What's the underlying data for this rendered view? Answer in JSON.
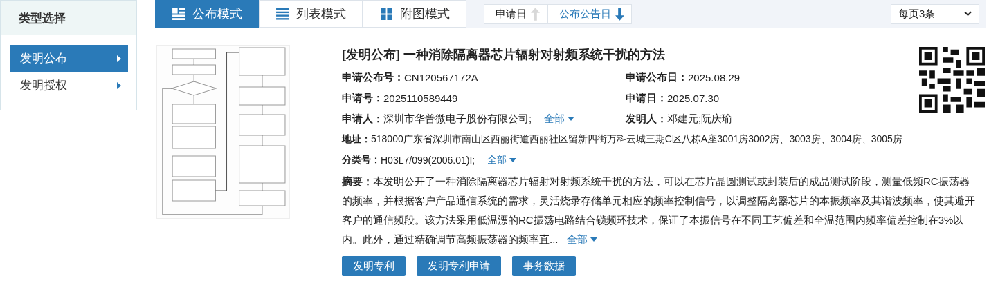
{
  "sidebar": {
    "title": "类型选择",
    "items": [
      {
        "label": "发明公布",
        "selected": true
      },
      {
        "label": "发明授权",
        "selected": false
      }
    ]
  },
  "view_tabs": [
    {
      "label": "公布模式",
      "kind": "publication",
      "selected": true
    },
    {
      "label": "列表模式",
      "kind": "list",
      "selected": false
    },
    {
      "label": "附图模式",
      "kind": "figure",
      "selected": false
    }
  ],
  "sort_buttons": [
    {
      "label": "申请日",
      "descending": false,
      "active": false
    },
    {
      "label": "公布公告日",
      "descending": true,
      "active": true
    }
  ],
  "page_size": {
    "value": "每页3条"
  },
  "result": {
    "tag": "[发明公布]",
    "title": "一种消除隔离器芯片辐射对射频系统干扰的方法",
    "fields": [
      {
        "label": "申请公布号：",
        "value": "CN120567172A"
      },
      {
        "label": "申请公布日：",
        "value": "2025.08.29"
      },
      {
        "label": "申请号：",
        "value": "2025110589449"
      },
      {
        "label": "申请日：",
        "value": "2025.07.30"
      },
      {
        "label": "申请人：",
        "value": "深圳市华普微电子股份有限公司;",
        "more": "全部"
      },
      {
        "label": "发明人：",
        "value": "邓建元;阮庆瑜"
      }
    ],
    "wide_fields": [
      {
        "label": "地址：",
        "value": "518000广东省深圳市南山区西丽街道西丽社区留新四街万科云城三期C区八栋A座3001房3002房、3003房、3004房、3005房"
      },
      {
        "label": "分类号：",
        "value": "H03L7/099(2006.01)I;",
        "more": "全部"
      }
    ],
    "abstract": {
      "label": "摘要：",
      "text": "本发明公开了一种消除隔离器芯片辐射对射频系统干扰的方法，可以在芯片晶圆测试或封装后的成品测试阶段，测量低频RC振荡器的频率，并根据客户产品通信系统的需求，灵活烧录存储单元相应的频率控制信号，以调整隔离器芯片的本振频率及其谐波频率，使其避开客户的通信频段。该方法采用低温漂的RC振荡电路结合锁频环技术，保证了本振信号在不同工艺偏差和全温范围内频率偏差控制在3%以内。此外，通过精确调节高频振荡器的频率直...",
      "more": "全部"
    },
    "buttons": [
      "发明专利",
      "发明专利申请",
      "事务数据"
    ]
  }
}
